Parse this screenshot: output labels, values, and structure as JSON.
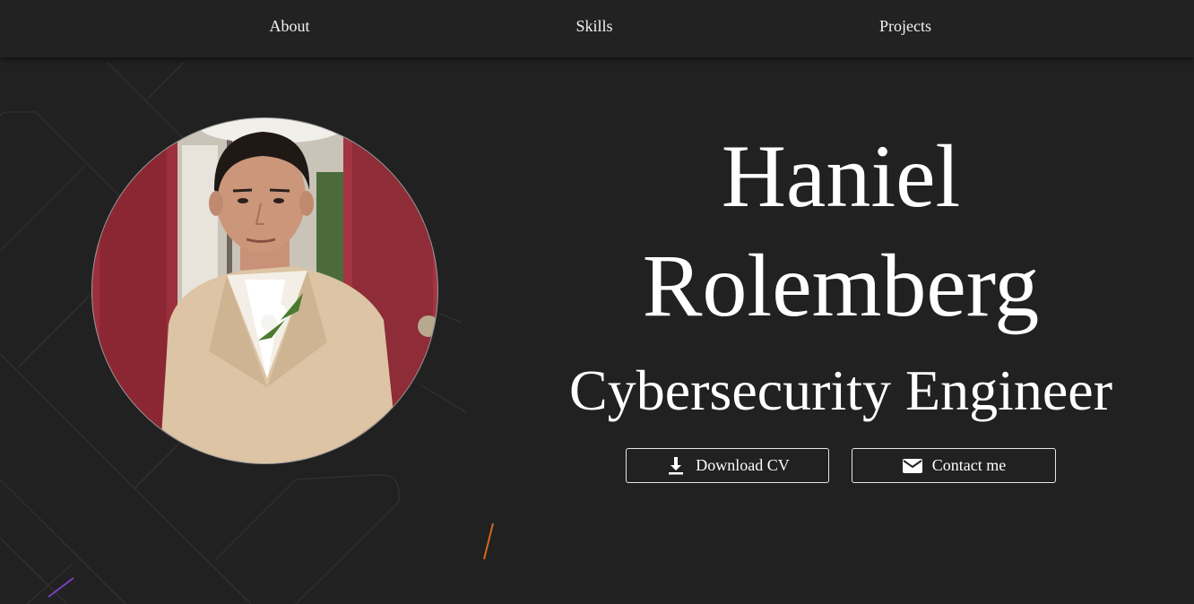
{
  "nav": {
    "items": [
      {
        "label": "About"
      },
      {
        "label": "Skills"
      },
      {
        "label": "Projects"
      }
    ]
  },
  "hero": {
    "name_line1": "Haniel",
    "name_line2": "Rolemberg",
    "title": "Cybersecurity Engineer",
    "buttons": {
      "download_cv": {
        "label": "Download CV",
        "icon": "download-icon"
      },
      "contact_me": {
        "label": "Contact me",
        "icon": "mail-icon"
      }
    }
  },
  "colors": {
    "background": "#212121",
    "navbar": "#222222",
    "text": "#ffffff",
    "button_border": "#e6e6e6"
  }
}
